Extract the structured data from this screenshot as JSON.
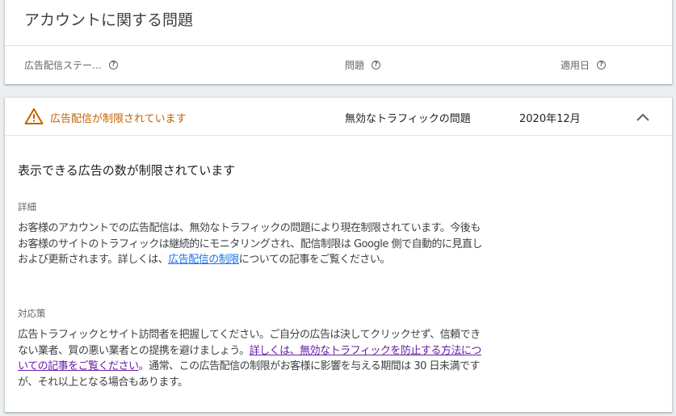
{
  "summary": {
    "title": "アカウントに関する問題",
    "columns": [
      {
        "label": "広告配信ステー…",
        "icon": "help-icon"
      },
      {
        "label": "問題",
        "icon": "help-icon"
      },
      {
        "label": "適用日",
        "icon": "help-icon"
      }
    ]
  },
  "issue_row": {
    "status": "広告配信が制限されています",
    "status_color": "#c26401",
    "status_icon": "warning-icon",
    "issue": "無効なトラフィックの問題",
    "date": "2020年12月",
    "toggle_icon": "chevron-up-icon"
  },
  "detail": {
    "headline": "表示できる広告の数が制限されています",
    "details_label": "詳細",
    "details_text_1": "お客様のアカウントでの広告配信は、無効なトラフィックの問題により現在制限されています。今後もお客様のサイトのトラフィックは継続的にモニタリングされ、配信制限は Google 側で自動的に見直しおよび更新されます。詳しくは、",
    "details_link": "広告配信の制限",
    "details_text_2": "についての記事をご覧ください。",
    "action_label": "対応策",
    "action_text_1": "広告トラフィックとサイト訪問者を把握してください。ご自分の広告は決してクリックせず、信頼できない業者、質の悪い業者との提携を避けましょう。",
    "action_link": "詳しくは、無効なトラフィックを防止する方法についての記事をご覧ください",
    "action_text_2": "。通常、この広告配信の制限がお客様に影響を与える期間は 30 日未満ですが、それ以上となる場合もあります。"
  }
}
